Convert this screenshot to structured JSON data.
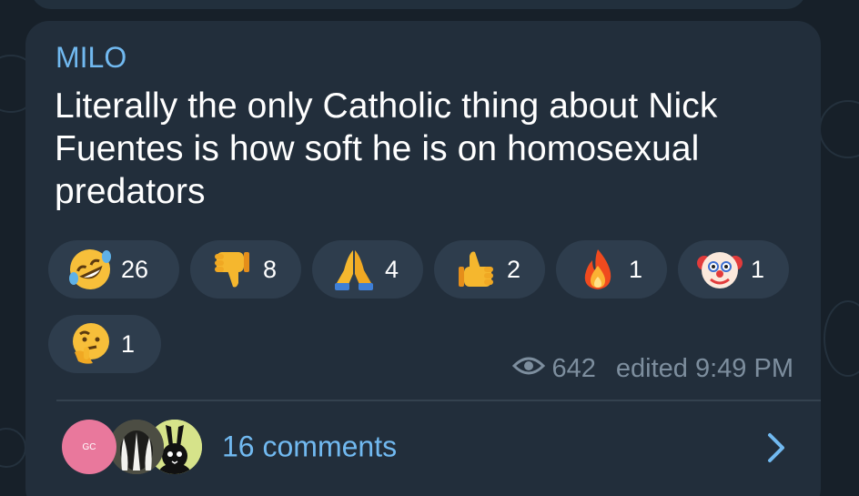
{
  "message": {
    "author": "MILO",
    "text": "Literally the only Catholic thing about Nick Fuentes is how soft he is on homosexual predators"
  },
  "reactions": [
    {
      "emoji": "rolling-on-floor-laughing",
      "count": "26"
    },
    {
      "emoji": "thumbs-down",
      "count": "8"
    },
    {
      "emoji": "folded-hands",
      "count": "4"
    },
    {
      "emoji": "thumbs-up",
      "count": "2"
    },
    {
      "emoji": "fire",
      "count": "1"
    },
    {
      "emoji": "clown-face",
      "count": "1"
    },
    {
      "emoji": "thinking-face",
      "count": "1"
    }
  ],
  "meta": {
    "views": "642",
    "edited": "edited 9:49 PM"
  },
  "comments": {
    "label": "16 comments",
    "avatar_initials": "GC"
  },
  "colors": {
    "accent": "#71b9f0",
    "bubble": "#222e3b",
    "reaction_bg": "#2e3d4d",
    "meta_text": "#7d8e9e"
  }
}
